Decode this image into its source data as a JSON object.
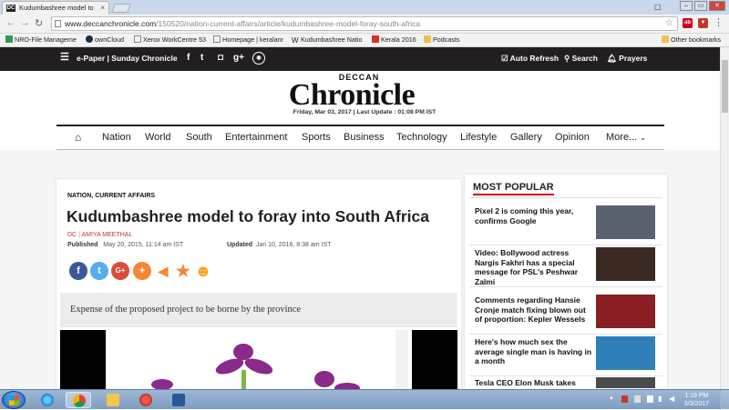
{
  "browser": {
    "tab_title": "Kudumbashree model to",
    "tab_favicon": "DC",
    "url_host": "www.deccanchronicle.com",
    "url_path": "/150520/nation-current-affairs/article/kudumbashree-model-foray-south-africa",
    "bookmarks": [
      {
        "label": "NRO-File Manageme",
        "icon": "green-grid-icon",
        "color": "#2e9b4a"
      },
      {
        "label": "ownCloud",
        "icon": "cloud-icon",
        "color": "#1d2d44"
      },
      {
        "label": "Xerox WorkCentre 53",
        "icon": "page-icon",
        "color": "#ffffff"
      },
      {
        "label": "Homepage | keralanr",
        "icon": "page-icon",
        "color": "#ffffff"
      },
      {
        "label": "Kudumbashree Natio",
        "icon": "w-icon",
        "color": "#ffffff"
      },
      {
        "label": "Kerala 2016",
        "icon": "red-play-icon",
        "color": "#d9302a"
      },
      {
        "label": "Podcasts",
        "icon": "folder-icon",
        "color": "#f0c24a"
      }
    ],
    "other_bookmarks": "Other bookmarks"
  },
  "site": {
    "epaper": "e-Paper | Sunday Chronicle",
    "auto_refresh": "Auto Refresh",
    "search": "Search",
    "prayers": "Prayers",
    "logo_top": "DECCAN",
    "logo_main": "Chronicle",
    "dateline": "Friday, Mar 03, 2017 | Last Update : 01:08 PM IST",
    "nav": [
      "Nation",
      "World",
      "South",
      "Entertainment",
      "Sports",
      "Business",
      "Technology",
      "Lifestyle",
      "Gallery",
      "Opinion",
      "More..."
    ],
    "accent": "#d0021b"
  },
  "article": {
    "category": "NATION, CURRENT AFFAIRS",
    "headline": "Kudumbashree model to foray into South Africa",
    "byline_source": "DC",
    "byline_author": "AMIYA MEETHAL",
    "published_label": "Published",
    "published_value": "May 20, 2015, 11:14 am IST",
    "updated_label": "Updated",
    "updated_value": "Jan 10, 2016, 8:38 am IST",
    "share_icons": [
      {
        "name": "facebook-icon",
        "glyph": "f",
        "color": "#3b5998"
      },
      {
        "name": "twitter-icon",
        "glyph": "t",
        "color": "#55acee"
      },
      {
        "name": "google-plus-icon",
        "glyph": "G+",
        "color": "#dd4b39"
      },
      {
        "name": "plus-icon",
        "glyph": "+",
        "color": "#f58634"
      },
      {
        "name": "megaphone-icon",
        "glyph": "◀",
        "color": "#f58634"
      },
      {
        "name": "star-icon",
        "glyph": "★",
        "color": "#f58634"
      },
      {
        "name": "smiley-icon",
        "glyph": "☻",
        "color": "#f5a623"
      }
    ],
    "summary": "Expense of the proposed project to be borne by the province"
  },
  "sidebar": {
    "title": "MOST POPULAR",
    "items": [
      {
        "text": "Pixel 2 is coming this year, confirms Google",
        "thumb": "#5a6270"
      },
      {
        "text": "Video: Bollywood actress Nargis Fakhri has a special message for PSL's Peshwar Zalmi",
        "thumb": "#3b2a22"
      },
      {
        "text": "Comments regarding Hansie Cronje match fixing blown out of proportion: Kepler Wessels",
        "thumb": "#8a1f24"
      },
      {
        "text": "Here's how much sex the average single man is having in a month",
        "thumb": "#2f7fb8"
      },
      {
        "text": "Tesla CEO Elon Musk takes",
        "thumb": "#4a4a4a"
      }
    ]
  },
  "taskbar": {
    "clock_time": "1:19 PM",
    "clock_date": "3/3/2017"
  }
}
